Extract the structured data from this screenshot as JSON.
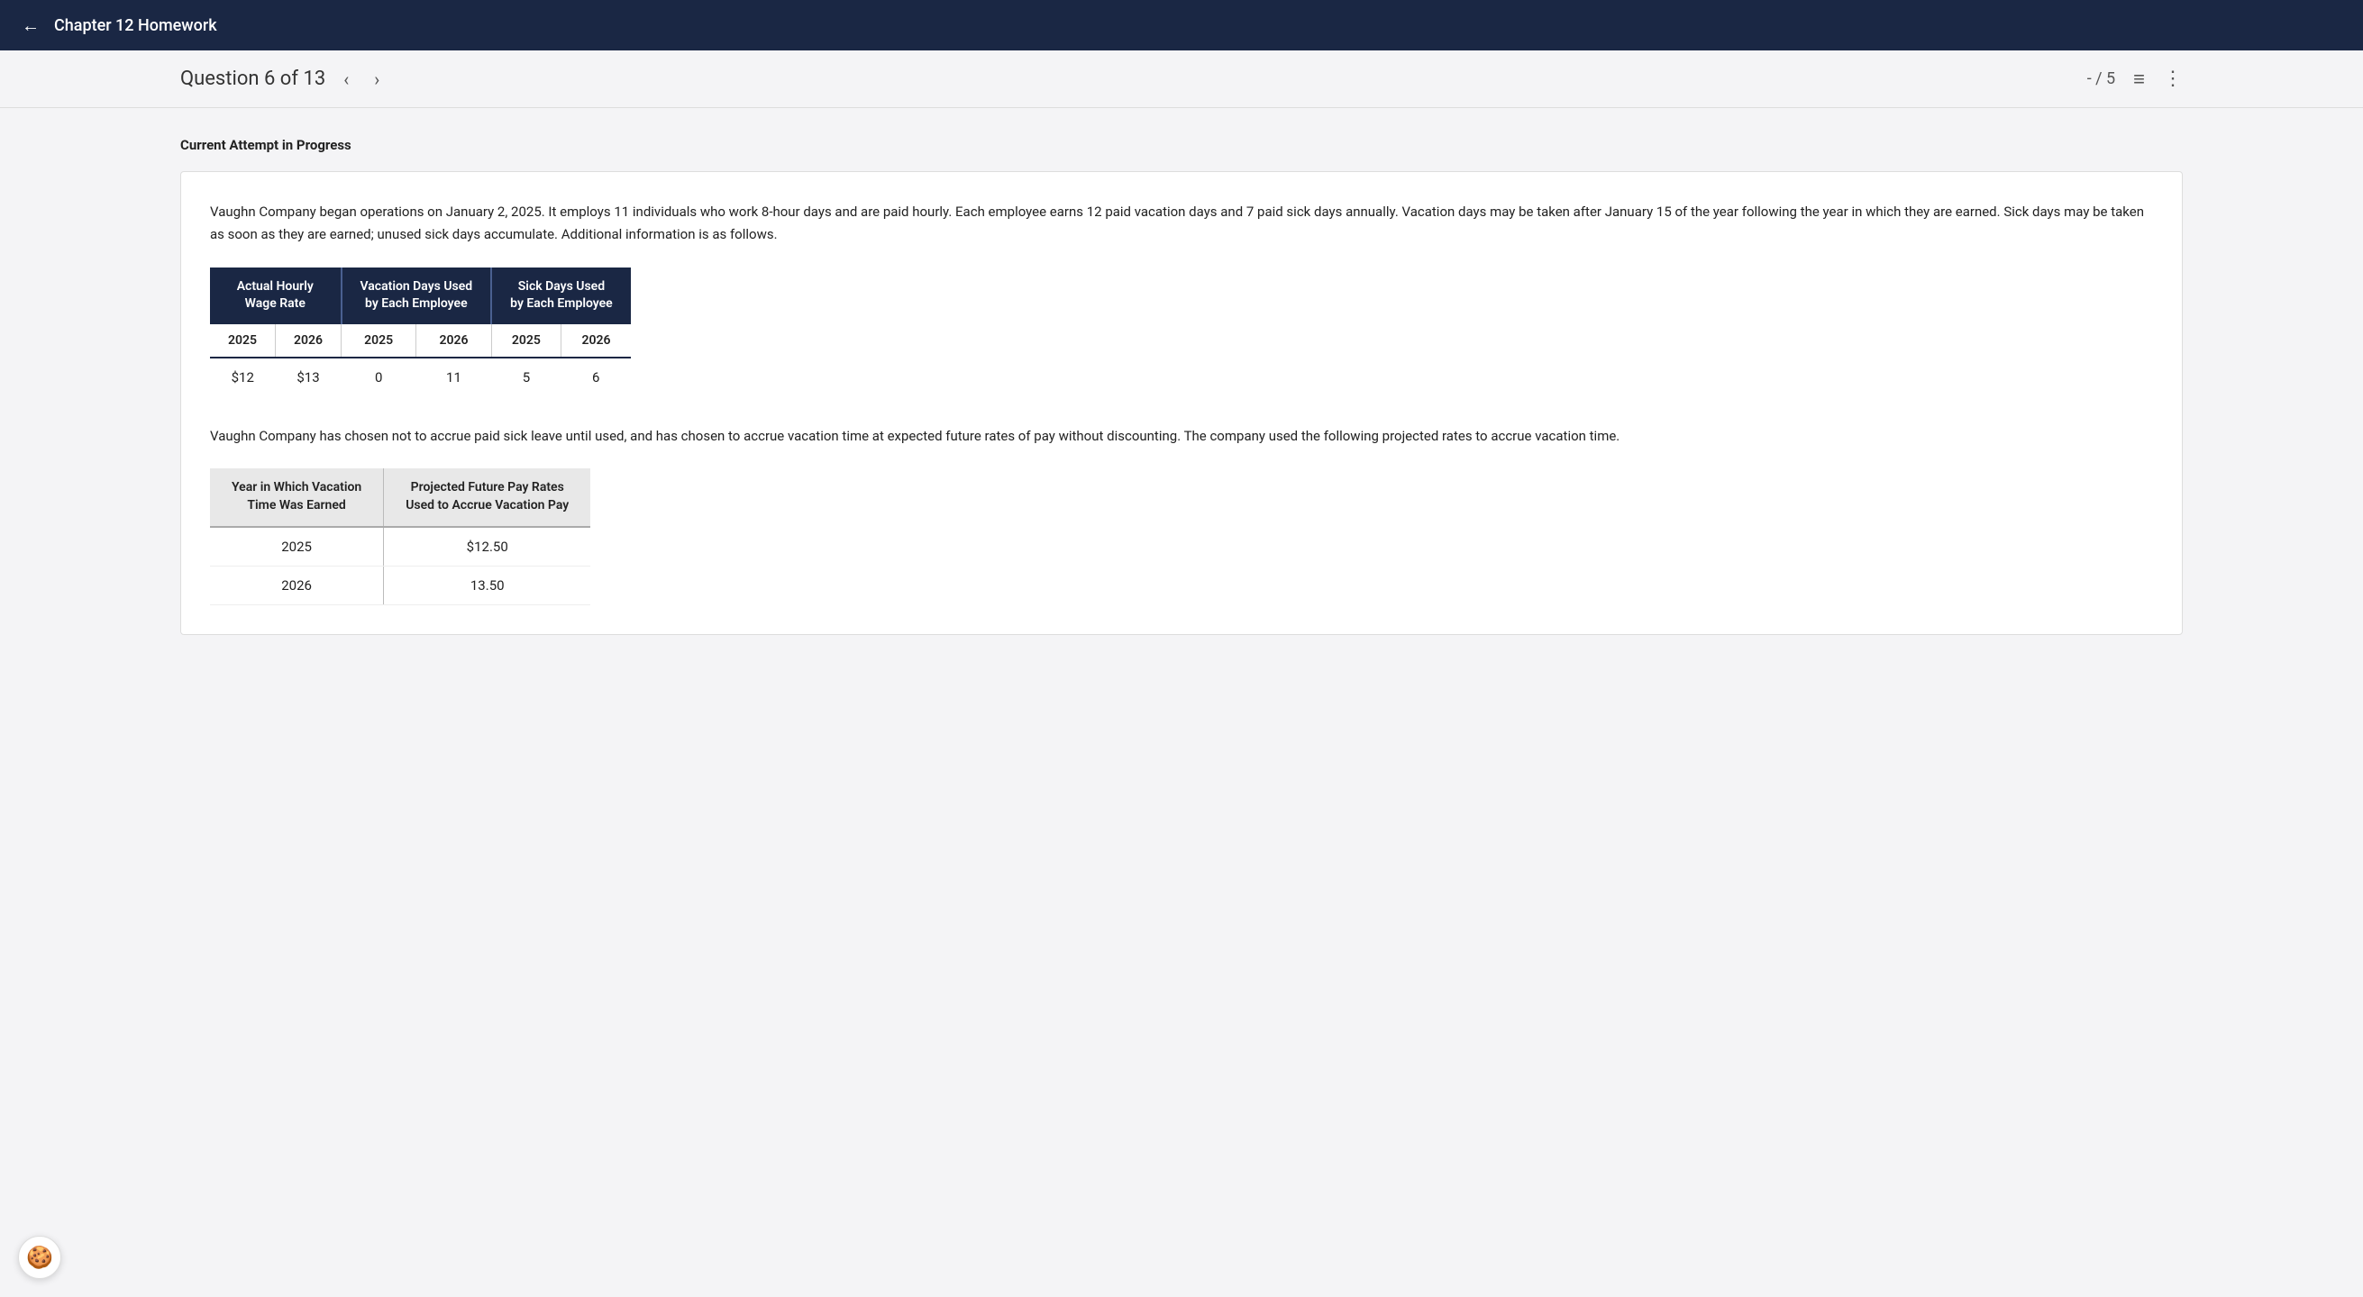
{
  "topNav": {
    "back_label": "←",
    "title": "Chapter 12 Homework"
  },
  "questionHeader": {
    "question_label": "Question 6 of 13",
    "prev_arrow": "‹",
    "next_arrow": "›",
    "score": "- / 5",
    "list_icon": "≡",
    "dots_icon": "⋮"
  },
  "attemptStatus": "Current Attempt in Progress",
  "questionBody": {
    "paragraph1": "Vaughn Company began operations on January 2, 2025. It employs 11 individuals who work 8-hour days and are paid hourly. Each employee earns 12 paid vacation days and 7 paid sick days annually. Vacation days may be taken after January 15 of the year following the year in which they are earned. Sick days may be taken as soon as they are earned; unused sick days accumulate. Additional information is as follows.",
    "table1": {
      "headers": [
        {
          "label": "Actual Hourly\nWage Rate",
          "colspan": 2
        },
        {
          "label": "Vacation Days Used\nby Each Employee",
          "colspan": 2
        },
        {
          "label": "Sick Days Used\nby Each Employee",
          "colspan": 2
        }
      ],
      "subheaders": [
        "2025",
        "2026",
        "2025",
        "2026",
        "2025",
        "2026"
      ],
      "data": [
        "$12",
        "$13",
        "0",
        "11",
        "5",
        "6"
      ]
    },
    "paragraph2": "Vaughn Company has chosen not to accrue paid sick leave until used, and has chosen to accrue vacation time at expected future rates of pay without discounting. The company used the following projected rates to accrue vacation time.",
    "table2": {
      "col1_header": "Year in Which Vacation\nTime Was Earned",
      "col2_header": "Projected Future Pay Rates\nUsed to Accrue Vacation Pay",
      "rows": [
        {
          "year": "2025",
          "rate": "$12.50"
        },
        {
          "year": "2026",
          "rate": "13.50"
        }
      ]
    }
  },
  "cookie_icon": "🍪"
}
